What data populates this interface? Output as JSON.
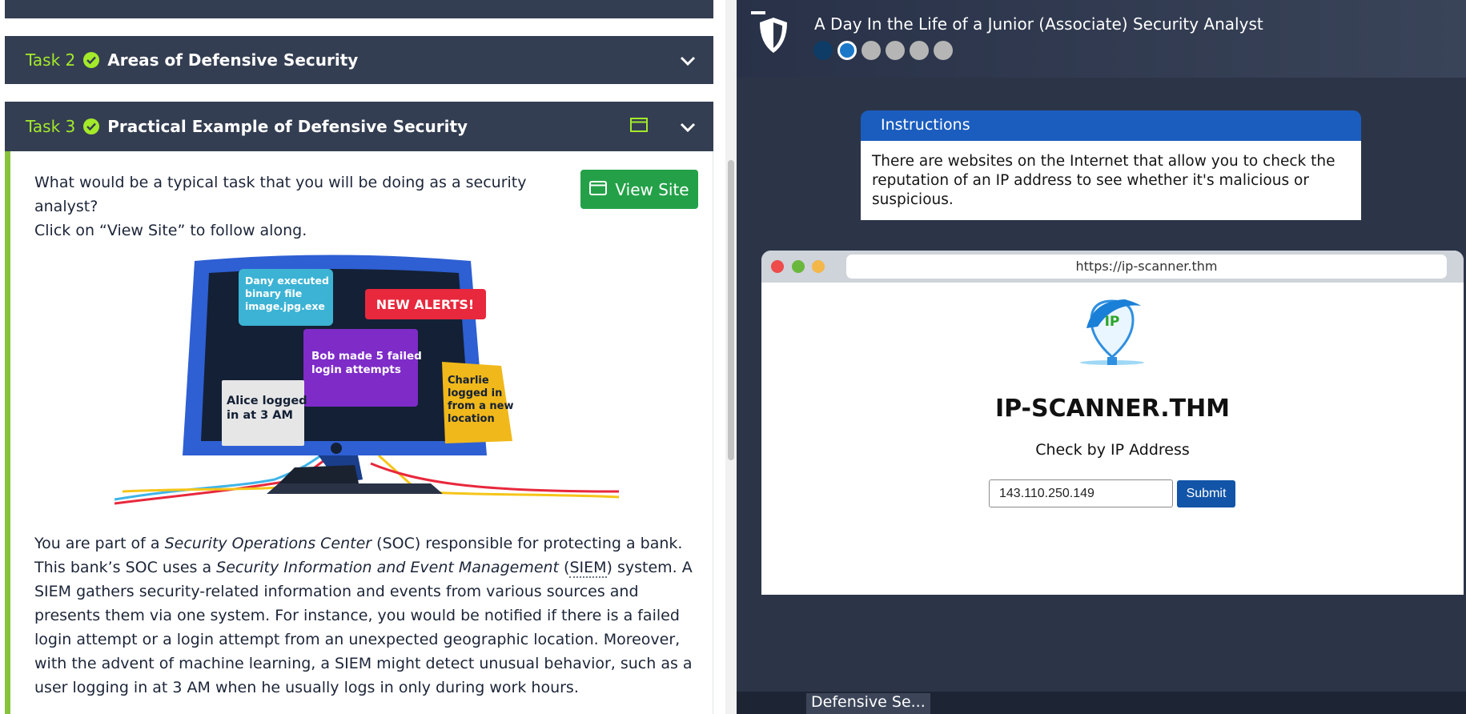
{
  "left": {
    "tasks": [
      {
        "prefix": "Task 2",
        "title": "Areas of Defensive Security"
      },
      {
        "prefix": "Task 3",
        "title": "Practical Example of Defensive Security"
      }
    ],
    "intro_line1": "What would be a typical task that you will be doing as a security analyst?",
    "intro_line2": "Click on “View Site” to follow along.",
    "view_site_label": "View Site",
    "monitor": {
      "alert_header": "NEW ALERTS!",
      "card_dany": [
        "Dany executed",
        "binary file",
        "image.jpg.exe"
      ],
      "card_bob": [
        "Bob made 5 failed",
        "login attempts"
      ],
      "card_alice": [
        "Alice logged",
        "in at 3 AM"
      ],
      "card_charlie": [
        "Charlie",
        "logged in",
        "from a new",
        "location"
      ]
    },
    "body": {
      "p1": "You are part of a ",
      "soc_em": "Security Operations Center",
      "p2": " (SOC) responsible for protecting a bank. This bank’s SOC uses a ",
      "siem_em": "Security Information and Event Management",
      "p3": " (",
      "siem_abbr": "SIEM",
      "p4": ") system. A SIEM gathers security-related information and events from various sources and presents them via one system. For instance, you would be notified if there is a failed login attempt or a login attempt from an unexpected geographic location. Moreover, with the advent of machine learning, a SIEM might detect unusual behavior, such as a user logging in at 3 AM when he usually logs in only during work hours."
    }
  },
  "right": {
    "room_title": "A Day In the Life of a Junior (Associate) Security Analyst",
    "progress": {
      "total_steps": 6,
      "completed": 1,
      "current": 2
    },
    "instructions_title": "Instructions",
    "instructions_text": "There are websites on the Internet that allow you to check the reputation of an IP address to see whether it's malicious or suspicious.",
    "browser": {
      "url": "https://ip-scanner.thm",
      "logo_text": "IP",
      "site_title": "IP-SCANNER.THM",
      "site_subtitle": "Check by IP Address",
      "ip_value": "143.110.250.149",
      "submit_label": "Submit"
    },
    "bottom_tab_label": "Defensive Se..."
  },
  "colors": {
    "task_accent": "#a3ea2a",
    "view_site_green": "#24a148",
    "instructions_blue": "#1b5dbe",
    "submit_blue": "#1154a8",
    "panel_dark": "#2c3548"
  }
}
